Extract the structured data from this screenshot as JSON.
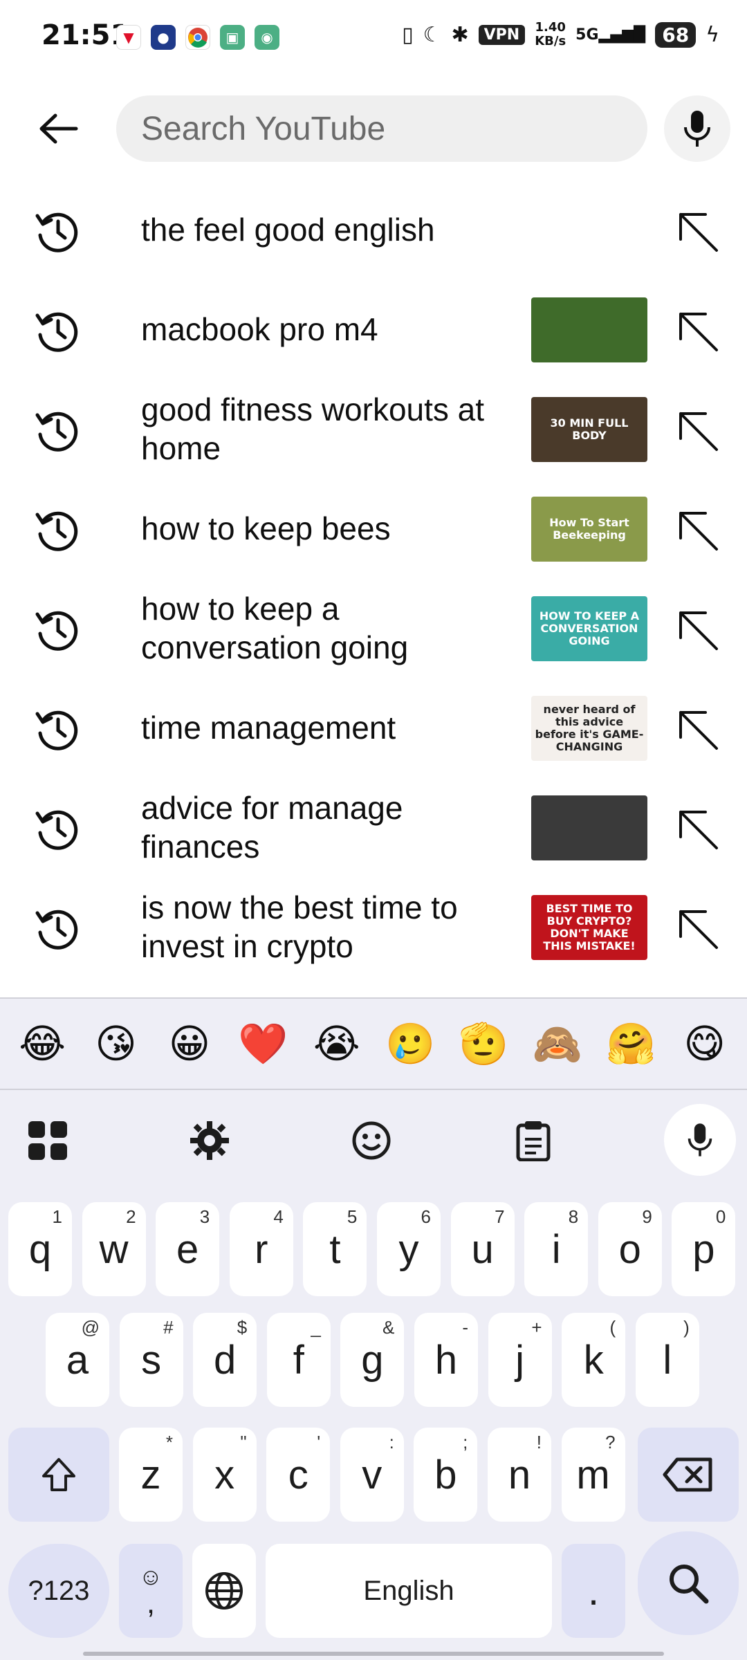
{
  "status_bar": {
    "time": "21:51",
    "vpn": "VPN",
    "speed_value": "1.40",
    "speed_unit": "KB/s",
    "network": "5G",
    "battery": "68"
  },
  "search": {
    "placeholder": "Search YouTube"
  },
  "suggestions": [
    {
      "text": "the feel good english",
      "thumb": null
    },
    {
      "text": "macbook pro m4",
      "thumb": {
        "caption": "",
        "bg": "#3f6b2a"
      }
    },
    {
      "text": "good fitness workouts at home",
      "thumb": {
        "caption": "30 MIN FULL BODY",
        "bg": "#4a3a2a"
      }
    },
    {
      "text": "how to keep bees",
      "thumb": {
        "caption": "How To Start Beekeeping",
        "bg": "#8a9a4a"
      }
    },
    {
      "text": "how to keep a conversation going",
      "thumb": {
        "caption": "HOW TO KEEP A CONVERSATION GOING",
        "bg": "#3aaca6"
      }
    },
    {
      "text": "time management",
      "thumb": {
        "caption": "never heard of this advice before it's GAME-CHANGING",
        "bg": "#f4f0ec"
      }
    },
    {
      "text": "advice for manage finances",
      "thumb": {
        "caption": "",
        "bg": "#3a3a3a"
      }
    },
    {
      "text": "is now the best time to invest in crypto",
      "thumb": {
        "caption": "BEST TIME TO BUY CRYPTO? DON'T MAKE THIS MISTAKE!",
        "bg": "#c0141c"
      }
    }
  ],
  "keyboard": {
    "emojis": [
      "😂",
      "😘",
      "😀",
      "❤️",
      "😭",
      "🥲",
      "🫡",
      "🙈",
      "🤗",
      "😋"
    ],
    "row1": [
      {
        "k": "q",
        "h": "1"
      },
      {
        "k": "w",
        "h": "2"
      },
      {
        "k": "e",
        "h": "3"
      },
      {
        "k": "r",
        "h": "4"
      },
      {
        "k": "t",
        "h": "5"
      },
      {
        "k": "y",
        "h": "6"
      },
      {
        "k": "u",
        "h": "7"
      },
      {
        "k": "i",
        "h": "8"
      },
      {
        "k": "o",
        "h": "9"
      },
      {
        "k": "p",
        "h": "0"
      }
    ],
    "row2": [
      {
        "k": "a",
        "h": "@"
      },
      {
        "k": "s",
        "h": "#"
      },
      {
        "k": "d",
        "h": "$"
      },
      {
        "k": "f",
        "h": "_"
      },
      {
        "k": "g",
        "h": "&"
      },
      {
        "k": "h",
        "h": "-"
      },
      {
        "k": "j",
        "h": "+"
      },
      {
        "k": "k",
        "h": "("
      },
      {
        "k": "l",
        "h": ")"
      }
    ],
    "row3": [
      {
        "k": "z",
        "h": "*"
      },
      {
        "k": "x",
        "h": "\""
      },
      {
        "k": "c",
        "h": "'"
      },
      {
        "k": "v",
        "h": ":"
      },
      {
        "k": "b",
        "h": ";"
      },
      {
        "k": "n",
        "h": "!"
      },
      {
        "k": "m",
        "h": "?"
      }
    ],
    "symbols_label": "?123",
    "comma_label": ",",
    "space_label": "English",
    "period_label": "."
  },
  "colors": {
    "keyboard_bg": "#eeeef6",
    "special_key": "#dfe1f5",
    "search_bg": "#efefef"
  }
}
